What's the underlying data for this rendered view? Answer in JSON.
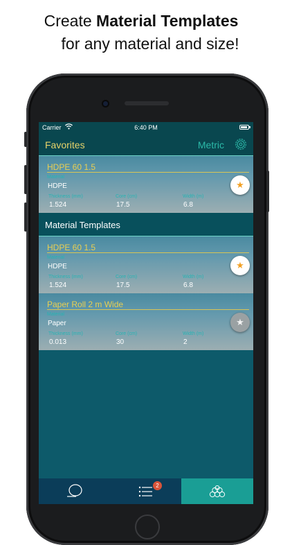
{
  "headline": {
    "prefix": "Create ",
    "bold": "Material Templates",
    "line2": "for any material and size!"
  },
  "status_bar": {
    "carrier": "Carrier",
    "time": "6:40 PM"
  },
  "nav": {
    "title": "Favorites",
    "unit": "Metric"
  },
  "labels": {
    "material": "Material",
    "thickness": "Thickness (mm)",
    "core": "Core (cm)",
    "width": "Width (m)"
  },
  "favorites": [
    {
      "name": "HDPE 60 1.5",
      "material": "HDPE",
      "thickness": "1.524",
      "core": "17.5",
      "width": "6.8",
      "favorited": true
    }
  ],
  "templates_section": {
    "title": "Material Templates"
  },
  "templates": [
    {
      "name": "HDPE 60 1.5",
      "material": "HDPE",
      "thickness": "1.524",
      "core": "17.5",
      "width": "6.8",
      "favorited": true
    },
    {
      "name": "Paper Roll 2 m Wide",
      "material": "Paper",
      "thickness": "0.013",
      "core": "30",
      "width": "2",
      "favorited": false
    }
  ],
  "tab_bar": {
    "tabs": [
      {
        "icon": "roll-icon"
      },
      {
        "icon": "list-icon",
        "badge": "2"
      },
      {
        "icon": "stack-icon",
        "active": true
      }
    ]
  },
  "colors": {
    "accent_yellow": "#e7d36a",
    "accent_teal": "#2bb9a8",
    "star": "#f2a024",
    "badge": "#d9543a"
  }
}
